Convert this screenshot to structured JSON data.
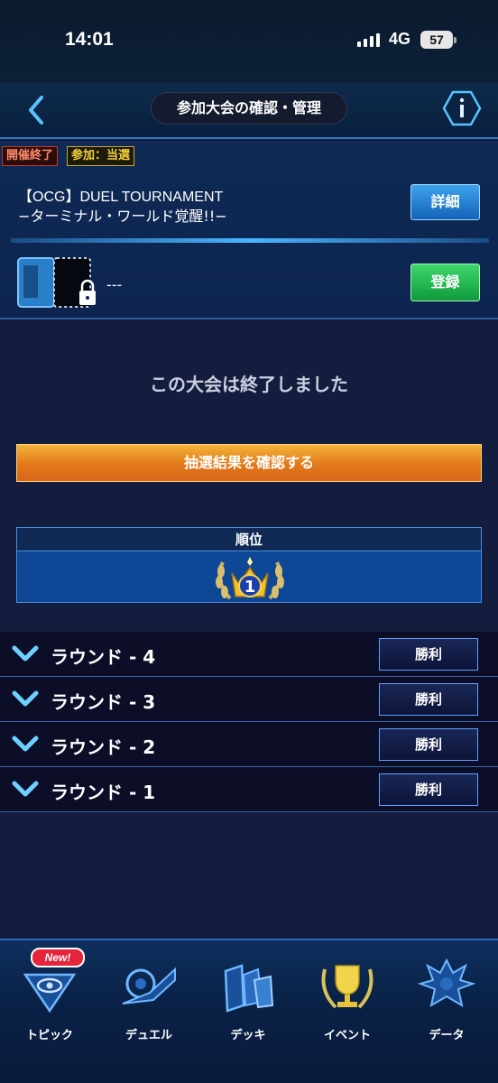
{
  "status_bar": {
    "time": "14:01",
    "network": "4G",
    "battery": "57"
  },
  "header": {
    "title": "参加大会の確認・管理",
    "back_icon": "chevron-left-icon",
    "info_icon": "info-icon"
  },
  "tournament": {
    "badges": {
      "status": "開催終了",
      "participation": "参加：当選"
    },
    "name_line1": "【OCG】DUEL TOURNAMENT",
    "name_line2": "−ターミナル・ワールド覚醒!!−",
    "detail_button": "詳細",
    "deck_name": "---",
    "register_button": "登録"
  },
  "main": {
    "ended_message": "この大会は終了しました",
    "result_button": "抽選結果を確認する",
    "rank": {
      "header": "順位",
      "value": "1"
    }
  },
  "rounds": [
    {
      "label": "ラウンド - 4",
      "result": "勝利"
    },
    {
      "label": "ラウンド - 3",
      "result": "勝利"
    },
    {
      "label": "ラウンド - 2",
      "result": "勝利"
    },
    {
      "label": "ラウンド - 1",
      "result": "勝利"
    }
  ],
  "bottom_nav": {
    "items": [
      {
        "label": "トピック",
        "icon": "topic-eye-icon",
        "badge": "New!"
      },
      {
        "label": "デュエル",
        "icon": "duel-disk-icon"
      },
      {
        "label": "デッキ",
        "icon": "deck-cards-icon"
      },
      {
        "label": "イベント",
        "icon": "trophy-icon"
      },
      {
        "label": "データ",
        "icon": "data-character-icon"
      }
    ]
  },
  "colors": {
    "accent_blue": "#2d7bc1",
    "detail_button": "#1f7fd6",
    "register_button": "#17b04c",
    "result_button": "#e98a24",
    "ended_badge": "#ff8a6a",
    "join_badge": "#f5d23c"
  }
}
